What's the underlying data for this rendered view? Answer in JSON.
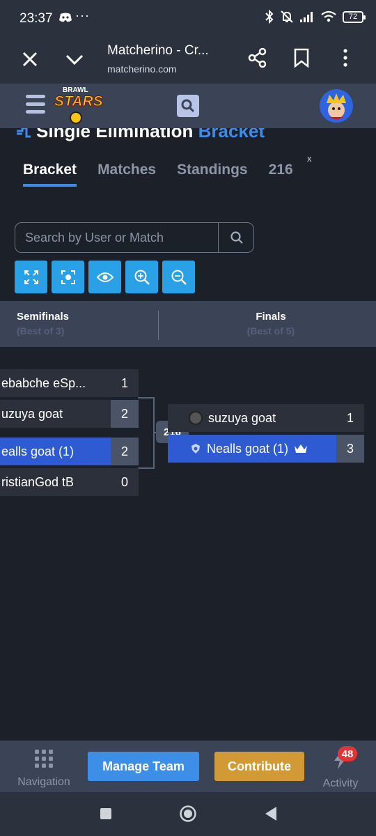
{
  "status": {
    "time": "23:37",
    "battery": "72"
  },
  "browser": {
    "title": "Matcherino - Cr...",
    "url": "matcherino.com"
  },
  "page": {
    "title_main": "Single Elimination",
    "title_accent": "Bracket"
  },
  "tabs": [
    {
      "label": "Bracket",
      "active": true
    },
    {
      "label": "Matches"
    },
    {
      "label": "Standings"
    },
    {
      "label": "216"
    }
  ],
  "tab_close": "x",
  "search": {
    "placeholder": "Search by User or Match"
  },
  "tools": [
    "expand-icon",
    "focus-icon",
    "eye-icon",
    "zoom-in-icon",
    "zoom-out-icon"
  ],
  "rounds": [
    {
      "name": "Semifinals",
      "sub": "(Best of 3)"
    },
    {
      "name": "Finals",
      "sub": "(Best of 5)"
    }
  ],
  "bracket": {
    "semi1": [
      {
        "name": "ebabche eSp...",
        "score": "1"
      },
      {
        "name": "uzuya goat",
        "score": "2"
      }
    ],
    "semi2": [
      {
        "name": "ealls goat (1)",
        "score": "2"
      },
      {
        "name": "ristianGod tB",
        "score": "0"
      }
    ],
    "final": [
      {
        "name": "suzuya goat",
        "score": "1"
      },
      {
        "name": "Nealls goat (1)",
        "score": "3"
      }
    ],
    "match_id": "216"
  },
  "bottom": {
    "navigation": "Navigation",
    "manage_team": "Manage Team",
    "contribute": "Contribute",
    "activity": "Activity",
    "activity_count": "48"
  },
  "colors": {
    "accent": "#3f8be8",
    "winner": "#2e5bd1",
    "tool": "#2aa1e6",
    "contribute": "#d19a35"
  }
}
